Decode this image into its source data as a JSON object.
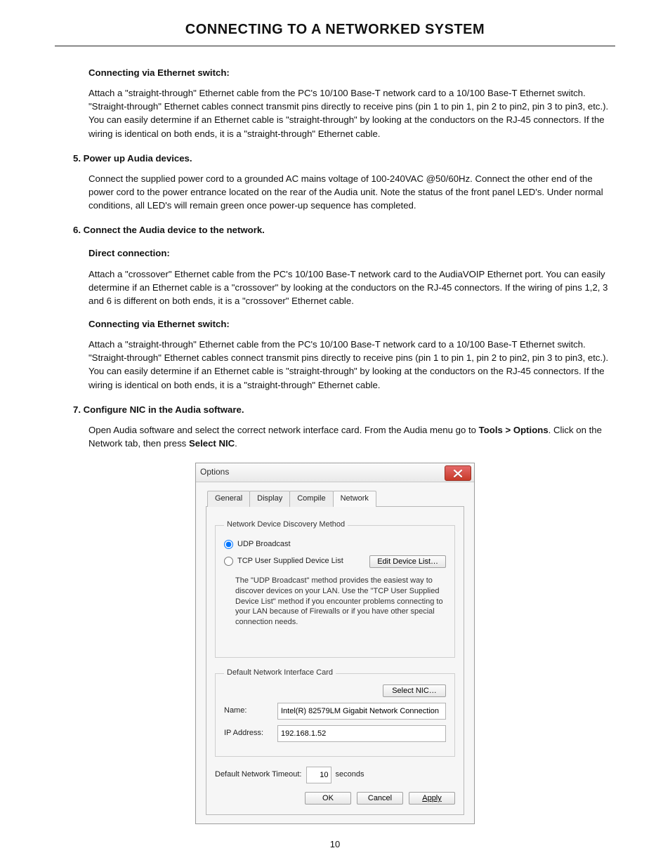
{
  "page_title": "CONNECTING TO A NETWORKED SYSTEM",
  "page_number": "10",
  "sections": {
    "ethswitch1_h": "Connecting via Ethernet switch:",
    "ethswitch1_p": "Attach a \"straight-through\" Ethernet cable from the PC's 10/100 Base-T network card to a 10/100 Base-T Ethernet switch. \"Straight-through\" Ethernet cables connect transmit pins directly to receive pins (pin 1 to pin 1, pin 2 to pin2, pin 3 to pin3, etc.). You can easily determine if an Ethernet cable is \"straight-through\" by looking at the conductors on the RJ-45 connectors. If the wiring is identical on both ends, it is a \"straight-through\" Ethernet cable.",
    "step5_h": "5. Power up Audia devices.",
    "step5_p": "Connect the supplied power cord to a grounded AC mains voltage of 100-240VAC @50/60Hz. Connect the other end of the power cord to the power entrance located on the rear of the Audia unit. Note the status of the front panel LED's. Under normal conditions, all LED's will remain green once power-up sequence has completed.",
    "step6_h": "6. Connect the Audia device to the network.",
    "direct_h": "Direct connection:",
    "direct_p": "Attach a \"crossover\" Ethernet cable from the PC's 10/100 Base-T network card to the AudiaVOIP Ethernet port. You can easily determine if an Ethernet cable is a \"crossover\" by looking at the conductors on the RJ-45 connectors. If the wiring of pins 1,2, 3 and 6 is different on both ends, it is a \"crossover\" Ethernet cable.",
    "ethswitch2_h": "Connecting via Ethernet switch:",
    "ethswitch2_p": "Attach a \"straight-through\" Ethernet cable from the PC's 10/100 Base-T network card to a 10/100 Base-T Ethernet switch. \"Straight-through\" Ethernet cables connect transmit pins directly to receive pins (pin 1 to pin 1, pin 2 to pin2, pin 3 to pin3, etc.). You can easily determine if an Ethernet cable is \"straight-through\" by looking at the conductors on the RJ-45 connectors. If the wiring is identical on both ends, it is a \"straight-through\" Ethernet cable.",
    "step7_h": "7. Configure NIC in the Audia software.",
    "step7_p1": "Open Audia software and select the correct network interface card. From the Audia menu go to ",
    "step7_p1b": "Tools > Options",
    "step7_p1c": ". Click on the Network tab, then press ",
    "step7_p1d": "Select NIC",
    "step7_p1e": "."
  },
  "dialog": {
    "title": "Options",
    "tabs": [
      "General",
      "Display",
      "Compile",
      "Network"
    ],
    "active_tab": "Network",
    "discovery_legend": "Network Device Discovery Method",
    "radio_udp": "UDP Broadcast",
    "radio_tcp": "TCP User Supplied Device List",
    "edit_list_btn": "Edit Device List…",
    "discovery_desc": "The \"UDP Broadcast\" method provides the easiest way to discover devices on your LAN.  Use the \"TCP User Supplied Device List\" method if you encounter problems connecting to your LAN because of Firewalls or if you have other special connection needs.",
    "nic_legend": "Default Network Interface Card",
    "select_nic_btn": "Select NIC…",
    "name_lbl": "Name:",
    "name_val": "Intel(R) 82579LM Gigabit Network Connection",
    "ip_lbl": "IP Address:",
    "ip_val": "192.168.1.52",
    "timeout_lbl": "Default Network Timeout:",
    "timeout_val": "10",
    "timeout_unit": "seconds",
    "buttons": {
      "ok": "OK",
      "cancel": "Cancel",
      "apply": "Apply"
    }
  }
}
